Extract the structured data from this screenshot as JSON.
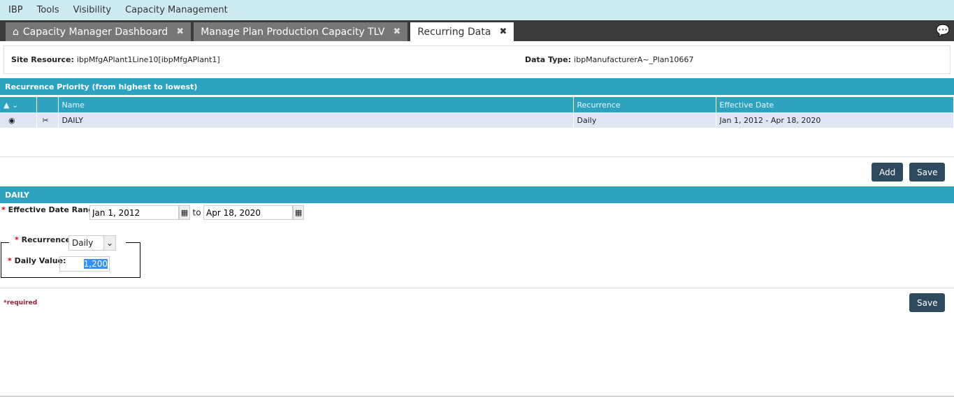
{
  "menu": [
    "IBP",
    "Tools",
    "Visibility",
    "Capacity Management"
  ],
  "tabs": [
    {
      "label": "Capacity Manager Dashboard"
    },
    {
      "label": "Manage Plan Production Capacity TLV"
    },
    {
      "label": "Recurring Data"
    }
  ],
  "info": {
    "site_label": "Site Resource:",
    "site_value": "ibpMfgAPlant1Line10[ibpMfgAPlant1]",
    "type_label": "Data Type:",
    "type_value": "ibpManufacturerA~_Plan10667"
  },
  "priority": {
    "title": "Recurrence Priority (from highest to lowest)",
    "columns": [
      "Name",
      "Recurrence",
      "Effective Date"
    ],
    "rows": [
      {
        "name": "DAILY",
        "recurrence": "Daily",
        "date": "Jan 1, 2012 - Apr 18, 2020"
      }
    ]
  },
  "buttons": {
    "add": "Add",
    "save": "Save"
  },
  "detail": {
    "title": "DAILY",
    "date_label": "Effective Date Range:",
    "from": "Jan 1, 2012",
    "to_label": "to",
    "to": "Apr 18, 2020",
    "recurrence_label": "Recurrence:",
    "recurrence": "Daily",
    "value_label": "Daily Value:",
    "value": "1,200",
    "required": "*required"
  }
}
